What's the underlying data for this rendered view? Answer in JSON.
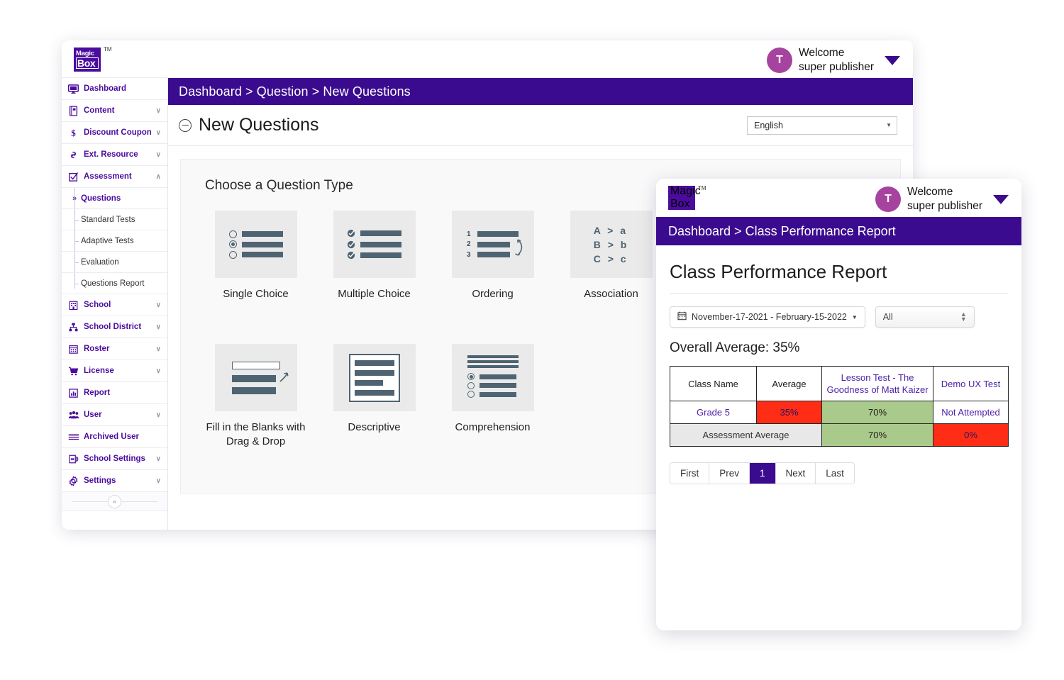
{
  "brand": {
    "logo_line1": "Magic",
    "logo_line2": "Box",
    "trademark": "TM",
    "accent": "#4B0C9E",
    "breadcrumb_bg": "#3B0B8F"
  },
  "window1": {
    "header": {
      "avatar_initial": "T",
      "welcome_line1": "Welcome",
      "welcome_line2": "super publisher"
    },
    "breadcrumb": "Dashboard > Question > New Questions",
    "page_title": "New Questions",
    "language_value": "English",
    "sidebar": {
      "items": [
        {
          "label": "Dashboard",
          "icon": "monitor-icon",
          "chevron": ""
        },
        {
          "label": "Content",
          "icon": "book-icon",
          "chevron": "∨"
        },
        {
          "label": "Discount Coupon",
          "icon": "dollar-icon",
          "chevron": "∨"
        },
        {
          "label": "Ext. Resource",
          "icon": "link-icon",
          "chevron": "∨"
        },
        {
          "label": "Assessment",
          "icon": "checkbox-icon",
          "chevron": "∧"
        }
      ],
      "sub_items": [
        {
          "label": "Questions",
          "active": true
        },
        {
          "label": "Standard Tests",
          "active": false
        },
        {
          "label": "Adaptive Tests",
          "active": false
        },
        {
          "label": "Evaluation",
          "active": false
        },
        {
          "label": "Questions Report",
          "active": false
        }
      ],
      "items_after": [
        {
          "label": "School",
          "icon": "building-icon",
          "chevron": "∨"
        },
        {
          "label": "School District",
          "icon": "org-chart-icon",
          "chevron": "∨"
        },
        {
          "label": "Roster",
          "icon": "calendar-icon",
          "chevron": "∨"
        },
        {
          "label": "License",
          "icon": "cart-icon",
          "chevron": "∨"
        },
        {
          "label": "Report",
          "icon": "bar-chart-icon",
          "chevron": ""
        },
        {
          "label": "User",
          "icon": "users-icon",
          "chevron": "∨"
        },
        {
          "label": "Archived User",
          "icon": "lines-icon",
          "chevron": ""
        },
        {
          "label": "School Settings",
          "icon": "school-settings-icon",
          "chevron": "∨"
        },
        {
          "label": "Settings",
          "icon": "gear-icon",
          "chevron": "∨"
        }
      ],
      "collapse_glyph": "«"
    },
    "panel": {
      "title": "Choose a Question Type",
      "question_types": [
        {
          "label": "Single Choice",
          "icon": "single-choice-icon"
        },
        {
          "label": "Multiple Choice",
          "icon": "multiple-choice-icon"
        },
        {
          "label": "Ordering",
          "icon": "ordering-icon"
        },
        {
          "label": "Association",
          "icon": "association-icon"
        },
        {
          "label": "Fill in the Blanks",
          "icon": "fill-blanks-icon"
        },
        {
          "label": "Fill in the Blanks with Drag & Drop",
          "icon": "fill-blanks-drag-icon"
        },
        {
          "label": "Descriptive",
          "icon": "descriptive-icon"
        },
        {
          "label": "Comprehension",
          "icon": "comprehension-icon"
        }
      ],
      "ordering_numbers": [
        "1",
        "2",
        "3"
      ],
      "association_rows": [
        "A  >  a",
        "B  >  b",
        "C  >  c"
      ],
      "fill_blanks_glyph": {
        "a": "A",
        "b": "B",
        "c": "C"
      }
    }
  },
  "window2": {
    "header": {
      "avatar_initial": "T",
      "welcome_line1": "Welcome",
      "welcome_line2": "super publisher"
    },
    "breadcrumb": "Dashboard > Class Performance Report",
    "page_title": "Class Performance Report",
    "date_range": "November-17-2021 - February-15-2022",
    "filter_value": "All",
    "overall_average": "Overall Average: 35%",
    "table": {
      "headers": [
        "Class Name",
        "Average",
        "Lesson Test - The Goodness of Matt Kaizer",
        "Demo UX Test"
      ],
      "rows": [
        {
          "cells": [
            {
              "text": "Grade 5",
              "style": "link"
            },
            {
              "text": "35%",
              "style": "red"
            },
            {
              "text": "70%",
              "style": "green"
            },
            {
              "text": "Not Attempted",
              "style": "link"
            }
          ]
        },
        {
          "cells": [
            {
              "text": "Assessment Average",
              "style": "grey",
              "colspan": 2
            },
            {
              "text": "70%",
              "style": "green"
            },
            {
              "text": "0%",
              "style": "red"
            }
          ]
        }
      ]
    },
    "pagination": [
      {
        "label": "First",
        "active": false
      },
      {
        "label": "Prev",
        "active": false
      },
      {
        "label": "1",
        "active": true
      },
      {
        "label": "Next",
        "active": false
      },
      {
        "label": "Last",
        "active": false
      }
    ],
    "colors": {
      "red": "#FF2D16",
      "green": "#A9CA8A",
      "grey": "#e8e8e8",
      "link": "#4B1FA8"
    }
  }
}
